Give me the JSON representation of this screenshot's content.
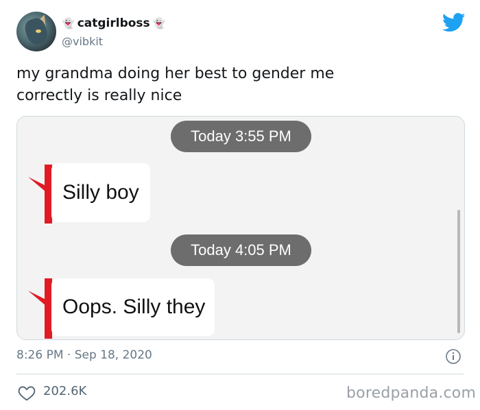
{
  "author": {
    "display_name": "catgirlboss",
    "handle": "@vibkit",
    "name_emoji": "👻"
  },
  "tweet": {
    "text_line1": "my grandma doing her best to gender me",
    "text_line2": "correctly is really nice",
    "time_line": "8:26 PM · Sep 18, 2020",
    "likes": "202.6K"
  },
  "media": {
    "messages": [
      {
        "timestamp": "Today 3:55 PM",
        "text": "Silly boy"
      },
      {
        "timestamp": "Today 4:05 PM",
        "text": "Oops. Silly they"
      }
    ]
  },
  "icons": {
    "logo": "twitter-bird-icon",
    "info": "info-icon",
    "like": "heart-icon"
  },
  "colors": {
    "twitter_blue": "#1da1f2",
    "bubble_bar_red": "#e01b24",
    "pill_gray": "#6d6d6d"
  },
  "watermark": "boredpanda.com"
}
